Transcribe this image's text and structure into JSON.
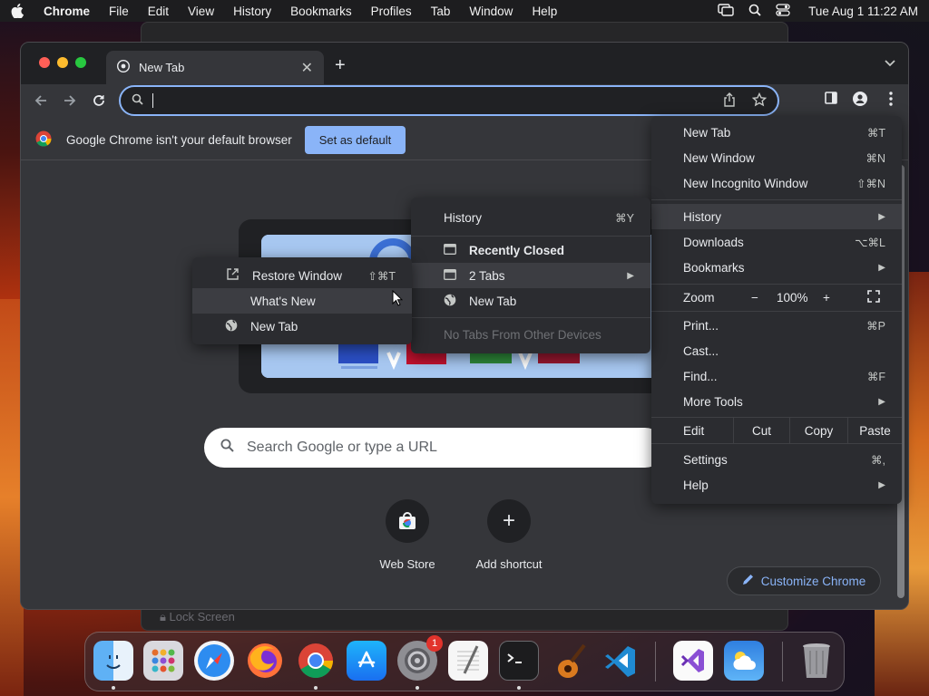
{
  "menubar": {
    "app": "Chrome",
    "items": [
      "File",
      "Edit",
      "View",
      "History",
      "Bookmarks",
      "Profiles",
      "Tab",
      "Window",
      "Help"
    ],
    "clock": "Tue Aug 1  11:22 AM"
  },
  "tab": {
    "title": "New Tab"
  },
  "infobar": {
    "message": "Google Chrome isn't your default browser",
    "button": "Set as default"
  },
  "ntp": {
    "search_placeholder": "Search Google or type a URL",
    "shortcuts": [
      {
        "label": "Web Store"
      },
      {
        "label": "Add shortcut"
      }
    ],
    "customize": "Customize Chrome"
  },
  "main_menu": {
    "new_tab": {
      "label": "New Tab",
      "shortcut": "⌘T"
    },
    "new_window": {
      "label": "New Window",
      "shortcut": "⌘N"
    },
    "new_incognito": {
      "label": "New Incognito Window",
      "shortcut": "⇧⌘N"
    },
    "history": {
      "label": "History"
    },
    "downloads": {
      "label": "Downloads",
      "shortcut": "⌥⌘L"
    },
    "bookmarks": {
      "label": "Bookmarks"
    },
    "zoom": {
      "label": "Zoom",
      "minus": "−",
      "value": "100%",
      "plus": "+"
    },
    "print": {
      "label": "Print...",
      "shortcut": "⌘P"
    },
    "cast": {
      "label": "Cast..."
    },
    "find": {
      "label": "Find...",
      "shortcut": "⌘F"
    },
    "more_tools": {
      "label": "More Tools"
    },
    "edit": {
      "label": "Edit",
      "cut": "Cut",
      "copy": "Copy",
      "paste": "Paste"
    },
    "settings": {
      "label": "Settings",
      "shortcut": "⌘,"
    },
    "help": {
      "label": "Help"
    }
  },
  "history_menu": {
    "history": {
      "label": "History",
      "shortcut": "⌘Y"
    },
    "recently_closed": "Recently Closed",
    "two_tabs": "2 Tabs",
    "new_tab": "New Tab",
    "no_tabs": "No Tabs From Other Devices"
  },
  "tabs_menu": {
    "restore": {
      "label": "Restore Window",
      "shortcut": "⇧⌘T"
    },
    "whats_new": "What's New",
    "new_tab": "New Tab"
  },
  "background": {
    "lock_screen": "Lock Screen"
  },
  "dock": {
    "apps": [
      "finder-icon",
      "launchpad-icon",
      "safari-icon",
      "firefox-icon",
      "chrome-icon",
      "app-store-icon",
      "system-settings-icon",
      "textedit-icon",
      "terminal-icon",
      "garageband-icon",
      "vscode-icon",
      "visual-studio-icon",
      "weather-icon",
      "trash-icon"
    ],
    "settings_badge": "1"
  },
  "colors": {
    "accent": "#8ab4f8",
    "menu_bg": "#2b2c30",
    "highlight": "#3c3d42"
  }
}
